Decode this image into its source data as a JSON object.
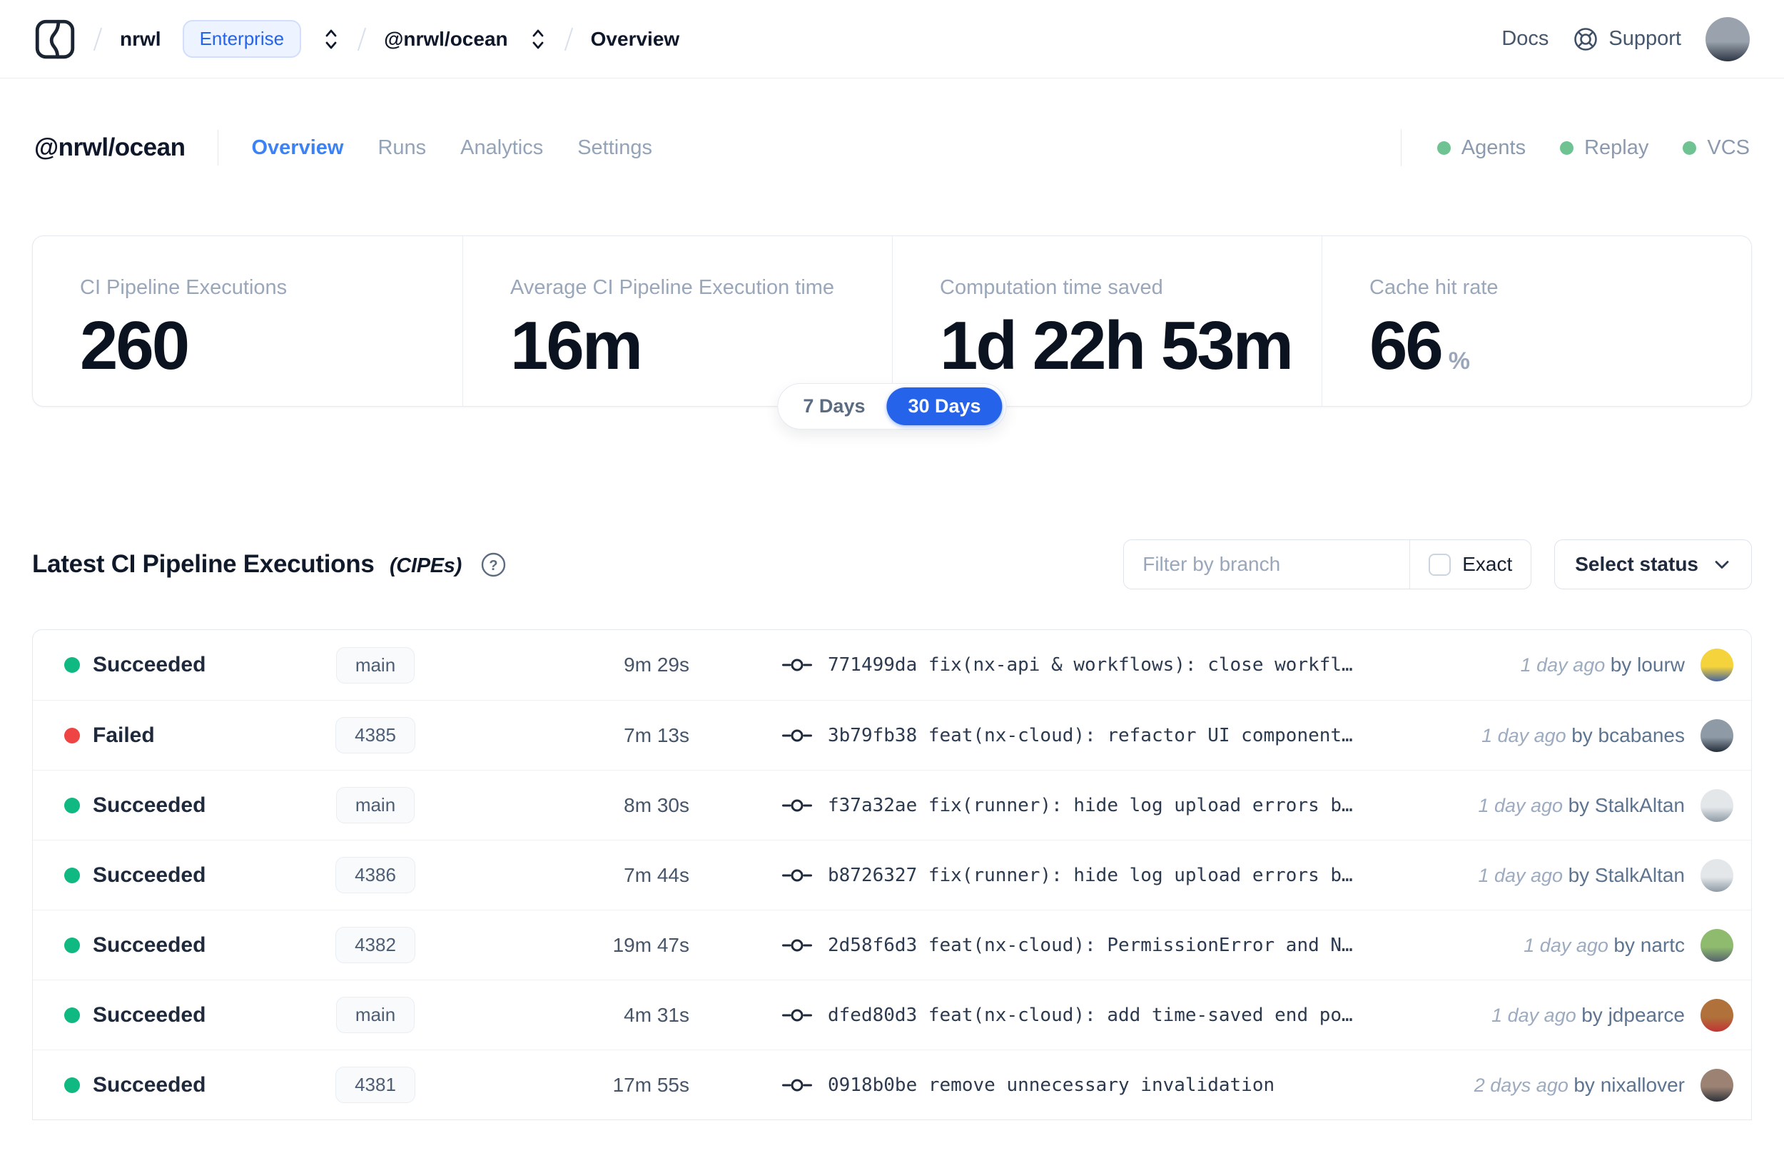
{
  "nav": {
    "breadcrumb": {
      "org": "nrwl",
      "org_badge": "Enterprise",
      "workspace": "@nrwl/ocean",
      "page": "Overview"
    },
    "docs_label": "Docs",
    "support_label": "Support",
    "user_avatar_colors": [
      "#9aa3ad",
      "#2b3442"
    ]
  },
  "header": {
    "title": "@nrwl/ocean",
    "tabs": [
      {
        "label": "Overview",
        "active": true
      },
      {
        "label": "Runs",
        "active": false
      },
      {
        "label": "Analytics",
        "active": false
      },
      {
        "label": "Settings",
        "active": false
      }
    ],
    "status_links": [
      {
        "label": "Agents"
      },
      {
        "label": "Replay"
      },
      {
        "label": "VCS"
      }
    ],
    "status_dot_color": "#6fc393"
  },
  "stats": {
    "cards": [
      {
        "label": "CI Pipeline Executions",
        "value": "260",
        "suffix": ""
      },
      {
        "label": "Average CI Pipeline Execution time",
        "value": "16m",
        "suffix": ""
      },
      {
        "label": "Computation time saved",
        "value": "1d 22h 53m",
        "suffix": ""
      },
      {
        "label": "Cache hit rate",
        "value": "66",
        "suffix": "%"
      }
    ],
    "range_toggle": {
      "options": [
        "7 Days",
        "30 Days"
      ],
      "selected": "30 Days"
    },
    "accent_color": "#2563eb"
  },
  "cipes": {
    "title": "Latest CI Pipeline Executions",
    "title_suffix": "(CIPEs)",
    "filter_placeholder": "Filter by branch",
    "exact_label": "Exact",
    "exact_checked": false,
    "status_dropdown_label": "Select status",
    "status_colors": {
      "green": "#10b981",
      "red": "#ef4444"
    },
    "rows": [
      {
        "status": "Succeeded",
        "status_color": "green",
        "branch": "main",
        "duration": "9m 29s",
        "commit": "771499da fix(nx-api & workflows): close workfl…",
        "time": "1 day ago",
        "author": "by lourw",
        "avatar_colors": [
          "#f5d33c",
          "#44639f"
        ]
      },
      {
        "status": "Failed",
        "status_color": "red",
        "branch": "4385",
        "duration": "7m 13s",
        "commit": "3b79fb38 feat(nx-cloud): refactor UI component…",
        "time": "1 day ago",
        "author": "by bcabanes",
        "avatar_colors": [
          "#8e9aa6",
          "#232c39"
        ]
      },
      {
        "status": "Succeeded",
        "status_color": "green",
        "branch": "main",
        "duration": "8m 30s",
        "commit": "f37a32ae fix(runner): hide log upload errors b…",
        "time": "1 day ago",
        "author": "by StalkAltan",
        "avatar_colors": [
          "#e3e7ea",
          "#8e9aa4"
        ]
      },
      {
        "status": "Succeeded",
        "status_color": "green",
        "branch": "4386",
        "duration": "7m 44s",
        "commit": "b8726327 fix(runner): hide log upload errors b…",
        "time": "1 day ago",
        "author": "by StalkAltan",
        "avatar_colors": [
          "#e3e7ea",
          "#8e9aa4"
        ]
      },
      {
        "status": "Succeeded",
        "status_color": "green",
        "branch": "4382",
        "duration": "19m 47s",
        "commit": "2d58f6d3 feat(nx-cloud): PermissionError and N…",
        "time": "1 day ago",
        "author": "by nartc",
        "avatar_colors": [
          "#8fbb6e",
          "#55616d"
        ]
      },
      {
        "status": "Succeeded",
        "status_color": "green",
        "branch": "main",
        "duration": "4m 31s",
        "commit": "dfed80d3 feat(nx-cloud): add time-saved end po…",
        "time": "1 day ago",
        "author": "by jdpearce",
        "avatar_colors": [
          "#b0713a",
          "#c03434"
        ]
      },
      {
        "status": "Succeeded",
        "status_color": "green",
        "branch": "4381",
        "duration": "17m 55s",
        "commit": "0918b0be remove unnecessary invalidation",
        "time": "2 days ago",
        "author": "by nixallover",
        "avatar_colors": [
          "#9b8273",
          "#2c3038"
        ]
      }
    ]
  }
}
